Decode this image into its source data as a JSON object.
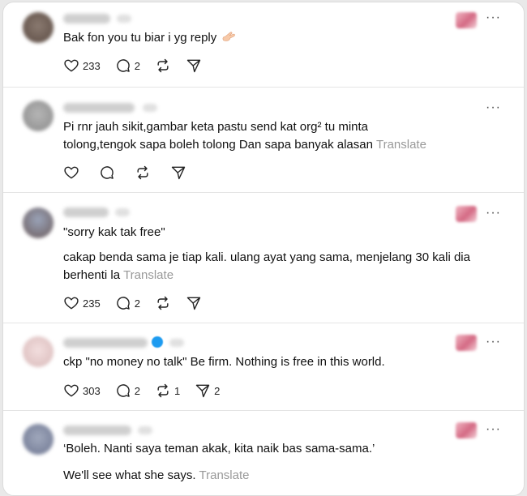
{
  "posts": [
    {
      "text": "Bak fon you tu biar i yg reply",
      "emoji": "hand-emoji",
      "counts": {
        "likes": "233",
        "replies": "2",
        "reposts": "",
        "shares": ""
      },
      "has_media": true
    },
    {
      "text_lines": [
        "Pi rnr jauh sikit,gambar keta pastu send kat org² tu minta",
        "tolong,tengok sapa boleh tolong Dan sapa banyak alasan"
      ],
      "translate": "Translate",
      "counts": {
        "likes": "",
        "replies": "",
        "reposts": "",
        "shares": ""
      },
      "has_media": false
    },
    {
      "quote": "\"sorry kak tak free\"",
      "text_lines": [
        "cakap benda sama je tiap kali. ulang ayat yang sama, menjelang 30 kali dia",
        "berhenti la"
      ],
      "translate": "Translate",
      "counts": {
        "likes": "235",
        "replies": "2",
        "reposts": "",
        "shares": ""
      },
      "has_media": true
    },
    {
      "text": "ckp \"no money no talk\" Be firm. Nothing is free in this world.",
      "counts": {
        "likes": "303",
        "replies": "2",
        "reposts": "1",
        "shares": "2"
      },
      "has_media": true,
      "verified": true
    },
    {
      "text": "‘Boleh. Nanti saya teman akak, kita naik bas sama-sama.’",
      "text_2": "We'll see what she says.",
      "translate": "Translate",
      "has_media": true
    }
  ],
  "icons": {
    "like": "heart-icon",
    "reply": "comment-icon",
    "repost": "repost-icon",
    "share": "send-icon",
    "more": "more-icon"
  },
  "colors": {
    "background": "#e9e9e9",
    "card": "#ffffff",
    "divider": "#e4e4e4",
    "muted": "#999999"
  }
}
